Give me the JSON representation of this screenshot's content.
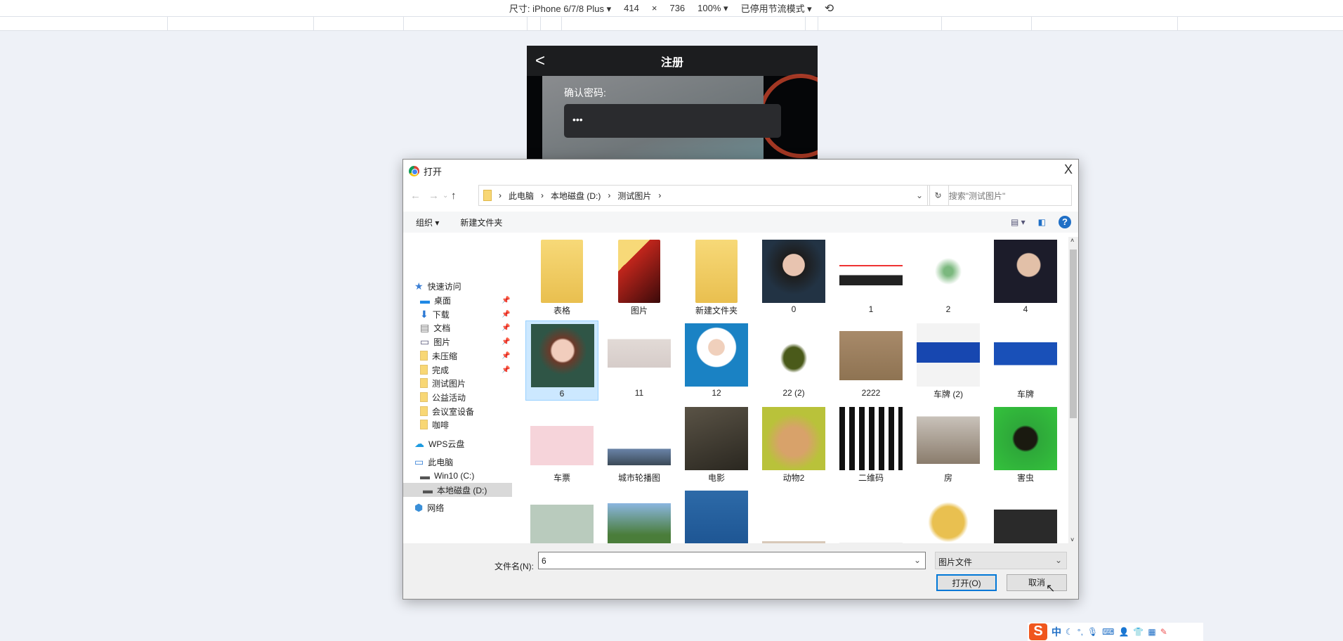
{
  "devtools": {
    "size_label": "尺寸: iPhone 6/7/8 Plus ▾",
    "width": "414",
    "times": "×",
    "height": "736",
    "zoom": "100% ▾",
    "throttle": "已停用节流模式 ▾",
    "rotate_icon": "rotate-icon"
  },
  "phone": {
    "back": "<",
    "title": "注册",
    "confirm_label": "确认密码:",
    "confirm_value": "•••"
  },
  "dialog": {
    "title": "打开",
    "close": "X",
    "breadcrumb": [
      "此电脑",
      "本地磁盘 (D:)",
      "测试图片"
    ],
    "search_placeholder": "搜索\"测试图片\"",
    "organize": "组织 ▾",
    "new_folder": "新建文件夹",
    "help": "?",
    "nav": [
      {
        "label": "快速访问",
        "icon": "star-icon"
      },
      {
        "label": "桌面",
        "icon": "desktop-icon",
        "pinned": true
      },
      {
        "label": "下载",
        "icon": "download-icon",
        "pinned": true
      },
      {
        "label": "文档",
        "icon": "document-icon",
        "pinned": true
      },
      {
        "label": "图片",
        "icon": "pictures-icon",
        "pinned": true
      },
      {
        "label": "未压缩",
        "icon": "folder-icon",
        "pinned": true
      },
      {
        "label": "完成",
        "icon": "folder-icon",
        "pinned": true
      },
      {
        "label": "测试图片",
        "icon": "folder-icon"
      },
      {
        "label": "公益活动",
        "icon": "folder-icon"
      },
      {
        "label": "会议室设备",
        "icon": "folder-icon"
      },
      {
        "label": "咖啡",
        "icon": "folder-icon"
      },
      {
        "label": "WPS云盘",
        "icon": "cloud-icon"
      },
      {
        "label": "此电脑",
        "icon": "computer-icon"
      },
      {
        "label": "Win10 (C:)",
        "icon": "drive-icon"
      },
      {
        "label": "本地磁盘 (D:)",
        "icon": "drive-icon",
        "selected": true
      },
      {
        "label": "网络",
        "icon": "network-icon"
      }
    ],
    "files": [
      {
        "name": "表格",
        "type": "folder"
      },
      {
        "name": "图片",
        "type": "folder"
      },
      {
        "name": "新建文件夹",
        "type": "folder"
      },
      {
        "name": "0",
        "type": "image"
      },
      {
        "name": "1",
        "type": "image"
      },
      {
        "name": "2",
        "type": "image"
      },
      {
        "name": "4",
        "type": "image"
      },
      {
        "name": "6",
        "type": "image",
        "selected": true
      },
      {
        "name": "11",
        "type": "image"
      },
      {
        "name": "12",
        "type": "image"
      },
      {
        "name": "22 (2)",
        "type": "image"
      },
      {
        "name": "2222",
        "type": "image"
      },
      {
        "name": "车牌 (2)",
        "type": "image"
      },
      {
        "name": "车牌",
        "type": "image"
      },
      {
        "name": "车票",
        "type": "image"
      },
      {
        "name": "城市轮播图",
        "type": "image"
      },
      {
        "name": "电影",
        "type": "image"
      },
      {
        "name": "动物2",
        "type": "image"
      },
      {
        "name": "二维码",
        "type": "image"
      },
      {
        "name": "房",
        "type": "image"
      },
      {
        "name": "害虫",
        "type": "image"
      },
      {
        "name": "",
        "type": "image"
      },
      {
        "name": "",
        "type": "image"
      },
      {
        "name": "",
        "type": "image"
      },
      {
        "name": "",
        "type": "image"
      },
      {
        "name": "",
        "type": "image"
      },
      {
        "name": "",
        "type": "image"
      },
      {
        "name": "",
        "type": "image"
      }
    ],
    "filename_label": "文件名(N):",
    "filename_value": "6",
    "filter": "图片文件",
    "open": "打开(O)",
    "cancel": "取消"
  },
  "ime": {
    "s": "S",
    "lang": "中"
  }
}
